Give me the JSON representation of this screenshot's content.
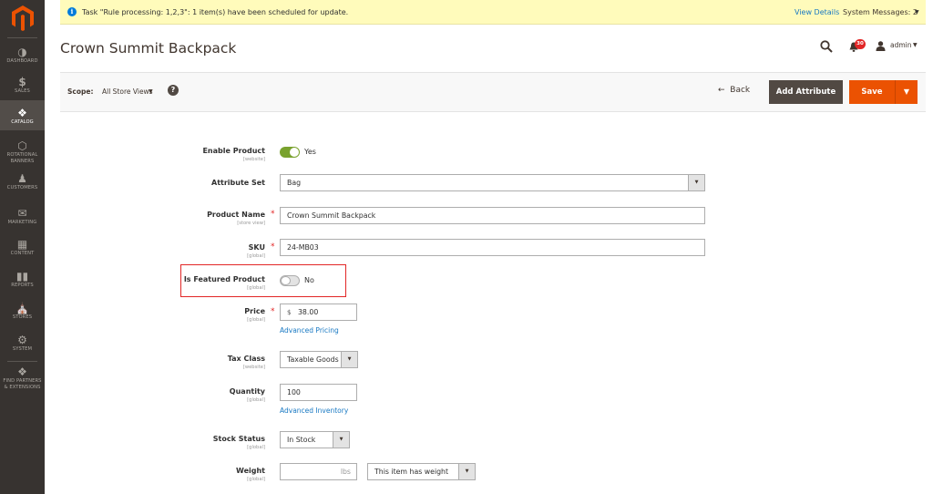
{
  "sidebar": {
    "items": [
      {
        "label": "DASHBOARD",
        "icon": "dashboard-icon"
      },
      {
        "label": "SALES",
        "icon": "dollar-icon"
      },
      {
        "label": "CATALOG",
        "icon": "box-icon",
        "active": true
      },
      {
        "label": "ROTATIONAL BANNERS",
        "icon": "hexagon-icon"
      },
      {
        "label": "CUSTOMERS",
        "icon": "person-icon"
      },
      {
        "label": "MARKETING",
        "icon": "megaphone-icon"
      },
      {
        "label": "CONTENT",
        "icon": "layout-icon"
      },
      {
        "label": "REPORTS",
        "icon": "bar-chart-icon"
      },
      {
        "label": "STORES",
        "icon": "store-icon"
      },
      {
        "label": "SYSTEM",
        "icon": "gear-icon"
      },
      {
        "label": "FIND PARTNERS & EXTENSIONS",
        "icon": "partners-icon"
      }
    ]
  },
  "notice": {
    "message": "Task \"Rule processing: 1,2,3\": 1 item(s) have been scheduled for update.",
    "view_details": "View Details",
    "system_messages": "System Messages: 2"
  },
  "header": {
    "title": "Crown Summit Backpack",
    "notification_count": "30",
    "user": "admin"
  },
  "actionbar": {
    "scope_label": "Scope:",
    "scope_value": "All Store Views",
    "back": "Back",
    "add_attribute": "Add Attribute",
    "save": "Save"
  },
  "form": {
    "enable_product": {
      "label": "Enable Product",
      "scope": "[website]",
      "value": "Yes",
      "enabled": true
    },
    "attribute_set": {
      "label": "Attribute Set",
      "value": "Bag"
    },
    "product_name": {
      "label": "Product Name",
      "scope": "[store view]",
      "value": "Crown Summit Backpack",
      "required": true
    },
    "sku": {
      "label": "SKU",
      "scope": "[global]",
      "value": "24-MB03",
      "required": true
    },
    "is_featured": {
      "label": "Is Featured Product",
      "scope": "[global]",
      "value": "No",
      "enabled": false
    },
    "price": {
      "label": "Price",
      "scope": "[global]",
      "currency": "$",
      "value": "38.00",
      "required": true,
      "link": "Advanced Pricing"
    },
    "tax_class": {
      "label": "Tax Class",
      "scope": "[website]",
      "value": "Taxable Goods"
    },
    "quantity": {
      "label": "Quantity",
      "scope": "[global]",
      "value": "100",
      "link": "Advanced Inventory"
    },
    "stock_status": {
      "label": "Stock Status",
      "scope": "[global]",
      "value": "In Stock"
    },
    "weight": {
      "label": "Weight",
      "scope": "[global]",
      "value": "",
      "unit": "lbs",
      "has_weight": "This item has weight"
    }
  },
  "colors": {
    "accent_orange": "#eb5202",
    "sidebar_bg": "#373330",
    "link_blue": "#1979c3",
    "toggle_on": "#79a22e",
    "highlight_red": "#e22626",
    "notice_bg": "#fffbbb"
  }
}
